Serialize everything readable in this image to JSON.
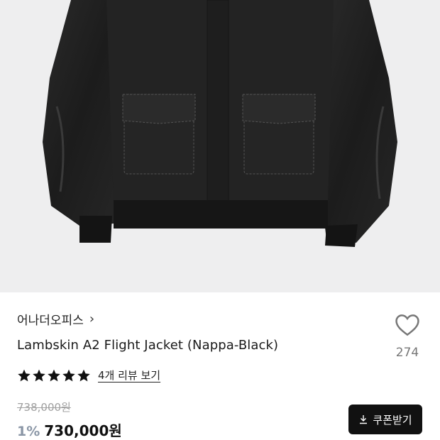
{
  "product": {
    "brand": "어나더오피스",
    "title": "Lambskin A2 Flight Jacket (Nappa-Black)",
    "review_label": "4개 리뷰 보기",
    "rating": 5,
    "original_price": "738,000원",
    "discount": "1%",
    "price": "730,000원"
  },
  "wishlist": {
    "count": "274"
  },
  "coupon": {
    "label": "쿠폰받기"
  },
  "colors": {
    "accent_discount": "#8a96a6",
    "button_bg": "#111111",
    "hero_bg": "#eeeeef"
  }
}
